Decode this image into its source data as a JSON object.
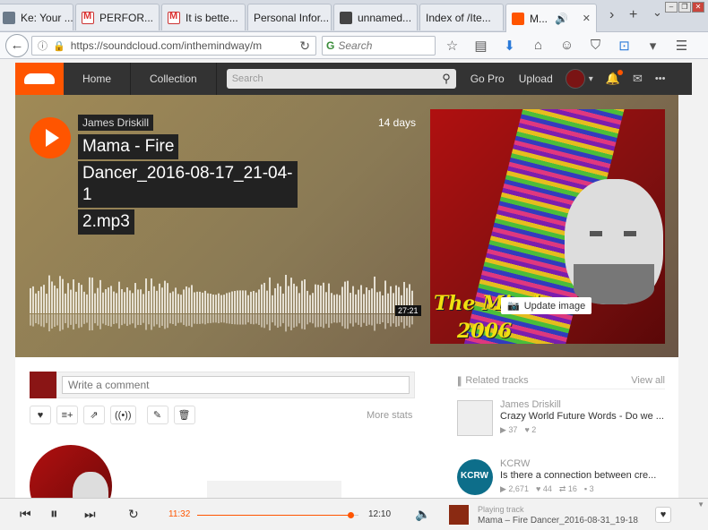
{
  "browser": {
    "tabs": [
      {
        "label": "Ke: Your ...",
        "icon": "doc-favicon",
        "active": false
      },
      {
        "label": "PERFOR...",
        "icon": "gmail-favicon",
        "active": false
      },
      {
        "label": "It is bette...",
        "icon": "gmail-favicon",
        "active": false
      },
      {
        "label": "Personal Infor...",
        "icon": "none",
        "active": false
      },
      {
        "label": "unnamed...",
        "icon": "image-favicon",
        "active": false
      },
      {
        "label": "Index of /Ite...",
        "icon": "none",
        "active": false
      },
      {
        "label": "M...",
        "icon": "soundcloud-favicon",
        "active": true
      }
    ],
    "tab_close": "✕",
    "tab_scroll": "›",
    "new_tab": "+",
    "tab_list": "⌄",
    "url": "https://soundcloud.com/inthemindway/m",
    "search_placeholder": "Search",
    "search_engine": "G"
  },
  "sc_header": {
    "nav": [
      "Home",
      "Collection"
    ],
    "search_placeholder": "Search",
    "go_pro": "Go Pro",
    "upload": "Upload",
    "more": "•••"
  },
  "hero": {
    "artist": "James Driskill",
    "title_lines": [
      "Mama - Fire",
      "Dancer_2016-08-17_21-04-1",
      "2.mp3"
    ],
    "age": "14 days",
    "duration": "27:21",
    "update_image": "Update image",
    "artwork_text_1": "The Mindway",
    "artwork_text_2": "2006"
  },
  "comment": {
    "placeholder": "Write a comment"
  },
  "actions": {
    "more_stats": "More stats"
  },
  "sidebar": {
    "heading": "Related tracks",
    "view_all": "View all",
    "tracks": [
      {
        "user": "James Driskill",
        "title": "Crazy World Future Words - Do we ...",
        "plays": "37",
        "likes": "2",
        "reposts": "",
        "comments": ""
      },
      {
        "user": "KCRW",
        "title": "Is there a connection between cre...",
        "plays": "2,671",
        "likes": "44",
        "reposts": "16",
        "comments": "3"
      }
    ]
  },
  "player": {
    "elapsed": "11:32",
    "total": "12:10",
    "progress": 0.948,
    "playing_label": "Playing track",
    "track_title": "Mama – Fire Dancer_2016-08-31_19-18..."
  },
  "colors": {
    "accent": "#ff5500",
    "header_bg": "#333333"
  }
}
